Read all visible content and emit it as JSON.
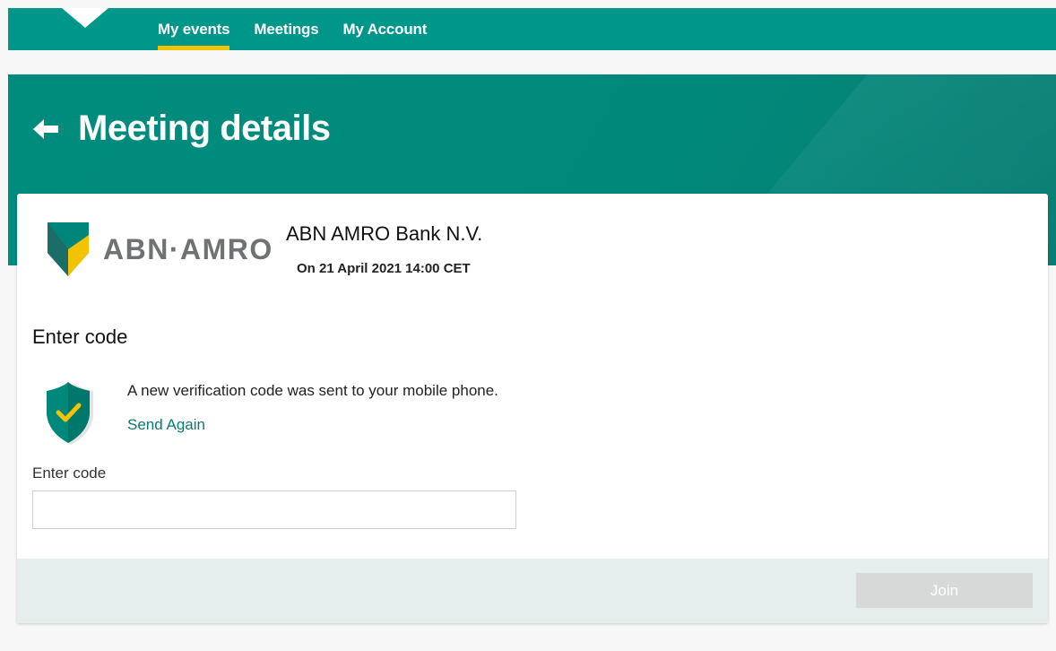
{
  "nav": {
    "items": [
      {
        "label": "My events",
        "active": true
      },
      {
        "label": "Meetings",
        "active": false
      },
      {
        "label": "My Account",
        "active": false
      }
    ]
  },
  "header": {
    "title": "Meeting details",
    "back_icon": "arrow-left-icon"
  },
  "meeting": {
    "logo_text": "ABN·AMRO",
    "company": "ABN AMRO Bank N.V.",
    "datetime": "On 21 April 2021 14:00 CET"
  },
  "verification": {
    "section_title": "Enter code",
    "icon": "shield-check-icon",
    "notice": "A new verification code was sent to your mobile phone.",
    "send_again": "Send Again",
    "code_label": "Enter code",
    "code_value": "",
    "code_placeholder": ""
  },
  "footer": {
    "join_label": "Join"
  },
  "colors": {
    "primary": "#00968a",
    "hero": "#008c7d",
    "accent": "#f2c400",
    "link": "#0a7a70",
    "disabled_button": "#d7d9d9"
  }
}
